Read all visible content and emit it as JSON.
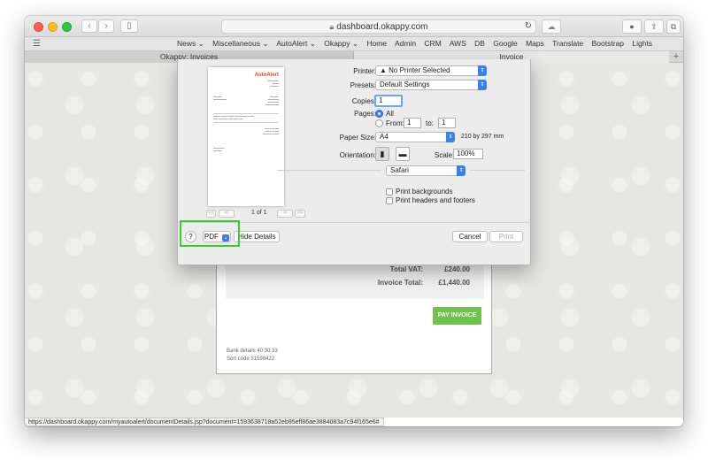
{
  "browser": {
    "address": "dashboard.okappy.com",
    "tabs": [
      {
        "label": "Okappy: Invoices"
      },
      {
        "label": "Invoice"
      }
    ],
    "favorites": [
      "News ⌄",
      "Miscellaneous ⌄",
      "AutoAlert ⌄",
      "Okappy ⌄",
      "Home",
      "Admin",
      "CRM",
      "AWS",
      "DB",
      "Google",
      "Maps",
      "Translate",
      "Bootstrap",
      "Lights"
    ],
    "status_url": "https://dashboard.okappy.com/myautoalert/documentDetails.jsp?document=1593638718a52eb95eff86ae3884083a7c94f165e6#"
  },
  "invoice": {
    "total_vat_label": "Total VAT:",
    "total_vat_value": "£240.00",
    "invoice_total_label": "Invoice Total:",
    "invoice_total_value": "£1,440.00",
    "pay_button": "PAY INVOICE",
    "bank_details": "Bank details 40 30 33",
    "sort_code": "Sort code 31598422"
  },
  "preview": {
    "logo": "AutoAlert",
    "page_label": "1 of 1",
    "first_btn": "<<",
    "prev_btn": "<",
    "next_btn": ">",
    "last_btn": ">>"
  },
  "print_dialog": {
    "printer_label": "Printer:",
    "printer_value": "▲ No Printer Selected",
    "presets_label": "Presets:",
    "presets_value": "Default Settings",
    "copies_label": "Copies:",
    "copies_value": "1",
    "pages_label": "Pages:",
    "pages_all": "All",
    "pages_from_label": "From:",
    "pages_from_value": "1",
    "pages_to_label": "to:",
    "pages_to_value": "1",
    "paper_size_label": "Paper Size:",
    "paper_size_value": "A4",
    "paper_size_dims": "210 by 297 mm",
    "orientation_label": "Orientation:",
    "scale_label": "Scale:",
    "scale_value": "100%",
    "app_section": "Safari",
    "print_backgrounds": "Print backgrounds",
    "print_headers": "Print headers and footers",
    "help_btn": "?",
    "pdf_btn": "PDF",
    "hide_details_btn": "Hide Details",
    "cancel_btn": "Cancel",
    "print_btn": "Print"
  }
}
